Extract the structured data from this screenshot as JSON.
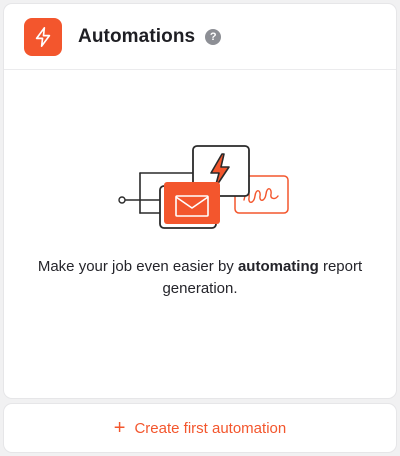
{
  "header": {
    "title": "Automations",
    "help_icon": "question-mark-icon",
    "help_glyph": "?",
    "app_icon": "lightning-bolt-icon"
  },
  "main": {
    "illustration_icons": [
      "flow-diagram",
      "lightning-bolt-icon",
      "envelope-icon",
      "signature-icon"
    ],
    "description": {
      "before": "Make your job even easier by ",
      "emphasis": "automating",
      "after": " report generation."
    }
  },
  "footer": {
    "plus_icon": "plus-icon",
    "plus_glyph": "+",
    "create_label": "Create first automation"
  },
  "colors": {
    "accent": "#f3562d",
    "text": "#24242a",
    "help_icon_bg": "#8d8f95"
  }
}
